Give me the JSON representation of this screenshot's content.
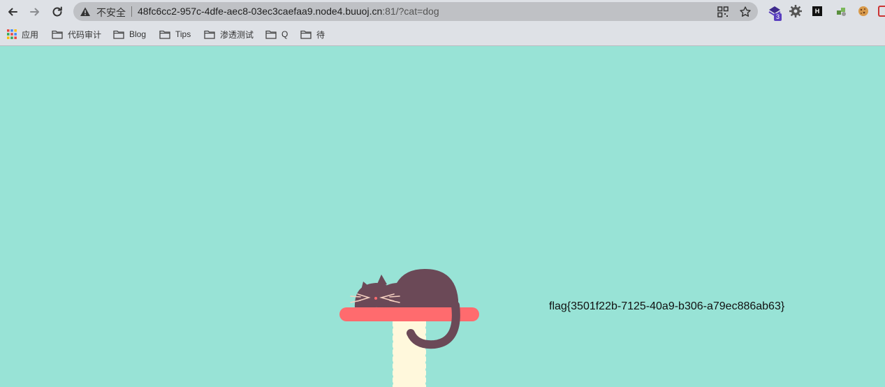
{
  "browser": {
    "security_label": "不安全",
    "url_host": "48fc6cc2-957c-4dfe-aec8-03ec3caefaa9.node4.buuoj.cn",
    "url_rest": ":81/?cat=dog",
    "extension_badge": "3",
    "extension_h_label": "H"
  },
  "bookmarks": [
    {
      "label": "应用",
      "icon": "apps-grid-icon"
    },
    {
      "label": "代码审计",
      "icon": "folder-icon"
    },
    {
      "label": "Blog",
      "icon": "folder-icon"
    },
    {
      "label": "Tips",
      "icon": "folder-icon"
    },
    {
      "label": "渗透测试",
      "icon": "folder-icon"
    },
    {
      "label": "Q",
      "icon": "folder-icon"
    },
    {
      "label": "待",
      "icon": "folder-icon"
    }
  ],
  "page": {
    "flag_text": "flag{3501f22b-7125-40a9-b306-a79ec886ab63}",
    "colors": {
      "background": "#98e3d6",
      "cat": "#6b4957",
      "shelf": "#ff6b6e",
      "post": "#fff8dc"
    }
  }
}
